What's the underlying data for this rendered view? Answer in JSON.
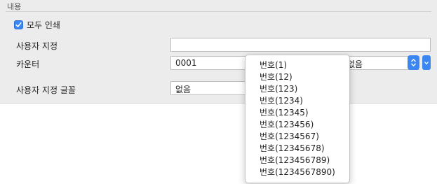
{
  "section": {
    "title": "내용"
  },
  "print_all": {
    "label": "모두 인쇄",
    "checked": true
  },
  "fields": {
    "custom_label": "사용자 지정",
    "custom_value": "",
    "counter_label": "카운터",
    "counter_value": "0001",
    "counter_format_value": "없음",
    "custom_font_label": "사용자 지정 글꼴",
    "custom_font_value": "없음"
  },
  "dropdown": {
    "items": [
      "번호(1)",
      "번호(12)",
      "번호(123)",
      "번호(1234)",
      "번호(12345)",
      "번호(123456)",
      "번호(1234567)",
      "번호(12345678)",
      "번호(123456789)",
      "번호(1234567890)"
    ]
  },
  "colors": {
    "accent": "#3b86f0",
    "panel_background": "#ececec"
  }
}
